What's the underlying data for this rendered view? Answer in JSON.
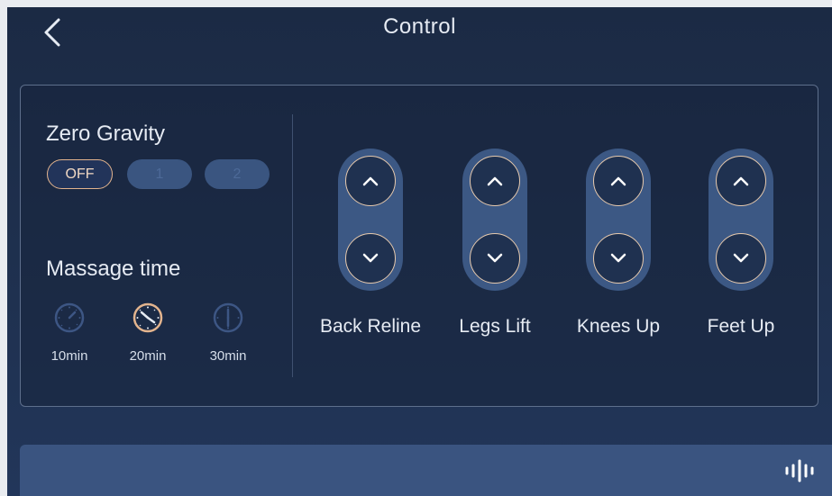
{
  "header": {
    "title": "Control"
  },
  "zero_gravity": {
    "title": "Zero Gravity",
    "options": [
      "OFF",
      "1",
      "2"
    ],
    "selected": "OFF"
  },
  "massage_time": {
    "title": "Massage time",
    "options": [
      "10min",
      "20min",
      "30min"
    ],
    "selected": "20min"
  },
  "controls": [
    {
      "label": "Back Reline"
    },
    {
      "label": "Legs Lift"
    },
    {
      "label": "Knees Up"
    },
    {
      "label": "Feet Up"
    }
  ],
  "icons": {
    "back": "chevron-left-icon",
    "up": "chevron-up-icon",
    "down": "chevron-down-icon",
    "timer": "clock-icon",
    "voice": "sound-wave-icon"
  },
  "colors": {
    "background": "#1f3150",
    "accent": "#e3b48e",
    "inactive": "#3a5580",
    "text": "#e6ebf3"
  }
}
